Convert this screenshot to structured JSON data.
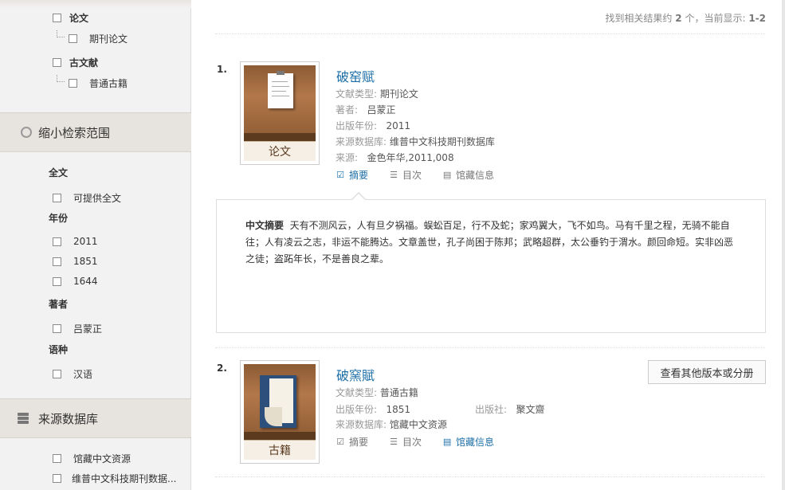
{
  "sidebar": {
    "type_tree": {
      "items": [
        {
          "label": "论文",
          "child": "期刊论文"
        },
        {
          "label": "古文献",
          "child": "普通古籍"
        }
      ]
    },
    "narrow_section": {
      "title": "缩小检索范围",
      "fulltext": {
        "label": "全文",
        "options": [
          "可提供全文"
        ]
      },
      "year": {
        "label": "年份",
        "options": [
          "2011",
          "1851",
          "1644"
        ]
      },
      "author": {
        "label": "著者",
        "options": [
          "吕蒙正"
        ]
      },
      "language": {
        "label": "语种",
        "options": [
          "汉语"
        ]
      }
    },
    "source_section": {
      "title": "来源数据库",
      "options": [
        "馆藏中文资源",
        "维普中文科技期刊数据..."
      ]
    }
  },
  "main": {
    "result_count": {
      "prefix": "找到相关结果约",
      "count": "2",
      "middle": "个，当前显示:",
      "range": "1-2"
    },
    "results": [
      {
        "num": "1.",
        "thumb_label": "论文",
        "title": "破窑赋",
        "type_label": "文献类型:",
        "type_value": "期刊论文",
        "author_label": "著者:",
        "author_value": "吕蒙正",
        "year_label": "出版年份:",
        "year_value": "2011",
        "db_label": "来源数据库:",
        "db_value": "维普中文科技期刊数据库",
        "source_label": "来源:",
        "source_value": "金色年华,2011,008",
        "actions": [
          "摘要",
          "目次",
          "馆藏信息"
        ]
      },
      {
        "num": "2.",
        "thumb_label": "古籍",
        "title": "破窯賦",
        "type_label": "文献类型:",
        "type_value": "普通古籍",
        "year_label": "出版年份:",
        "year_value": "1851",
        "publisher_label": "出版社:",
        "publisher_value": "聚文齋",
        "db_label": "来源数据库:",
        "db_value": "馆藏中文资源",
        "actions": [
          "摘要",
          "目次",
          "馆藏信息"
        ],
        "other_button": "查看其他版本或分册"
      }
    ],
    "abstract": {
      "label": "中文摘要",
      "text": "天有不测风云，人有旦夕祸福。蜈蚣百足，行不及蛇；家鸡翼大，飞不如鸟。马有千里之程，无骑不能自往；人有凌云之志，非运不能腾达。文章盖世，孔子尚困于陈邦；武略超群，太公垂钓于渭水。颜回命短。实非凶恶之徒；盗跖年长，不是善良之辈。"
    }
  }
}
